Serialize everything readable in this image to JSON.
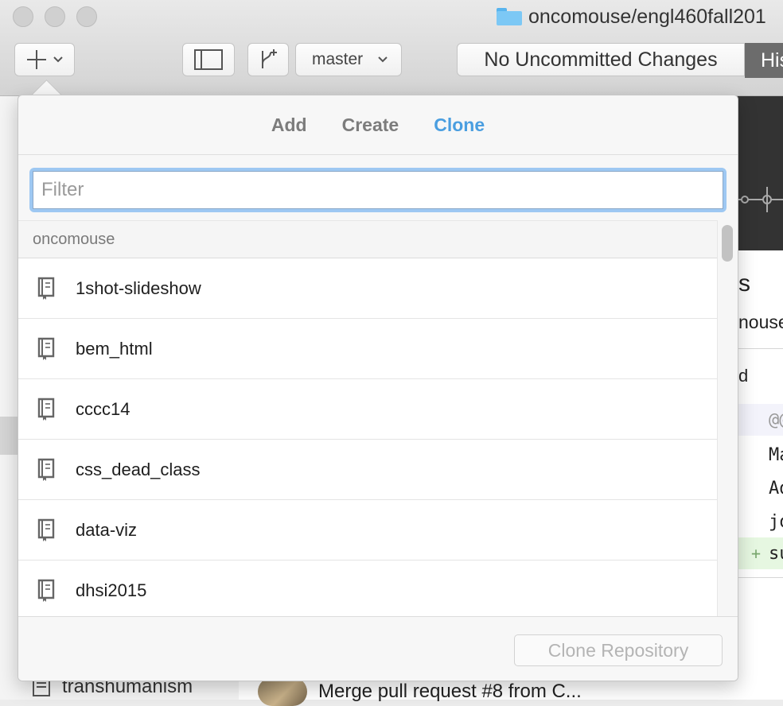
{
  "window": {
    "title": "oncomouse/engl460fall201"
  },
  "toolbar": {
    "branch_label": "master",
    "uncommitted_label": "No Uncommitted Changes",
    "history_label": "His"
  },
  "background": {
    "heading_fragment": "s",
    "owner_fragment": "nouse",
    "tab_fragment": "d",
    "diff_lines": [
      "@@",
      "Ma",
      "Ad",
      "jo",
      "su"
    ],
    "diff_add_marker": "+",
    "sidebar_bottom_item": "transhumanism",
    "commit_bottom_item": "Merge pull request #8 from C..."
  },
  "popover": {
    "tabs": [
      {
        "label": "Add"
      },
      {
        "label": "Create"
      },
      {
        "label": "Clone"
      }
    ],
    "active_tab": "Clone",
    "filter": {
      "placeholder": "Filter",
      "value": ""
    },
    "group": {
      "label": "oncomouse"
    },
    "repositories": [
      {
        "name": "1shot-slideshow"
      },
      {
        "name": "bem_html"
      },
      {
        "name": "cccc14"
      },
      {
        "name": "css_dead_class"
      },
      {
        "name": "data-viz"
      },
      {
        "name": "dhsi2015"
      }
    ],
    "clone_button_label": "Clone Repository"
  },
  "colors": {
    "accent": "#4a9ee0",
    "filter_focus_ring": "#9ec8f2",
    "history_button": "#6c6c6c"
  }
}
